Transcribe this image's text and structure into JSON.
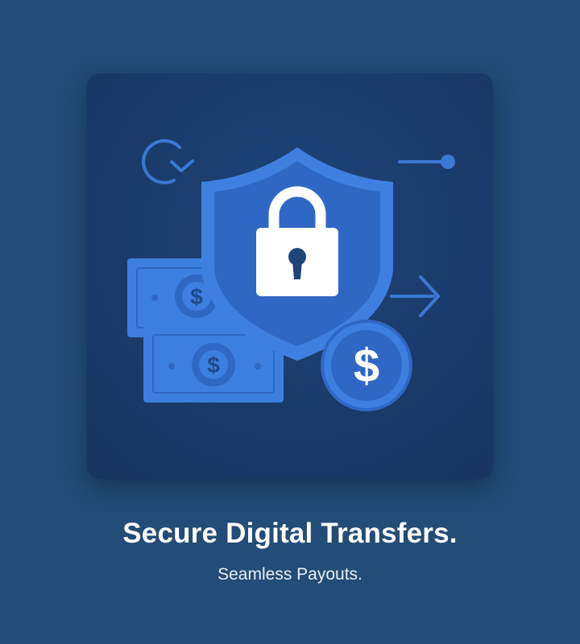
{
  "onboarding": {
    "headline": "Secure Digital Transfers.",
    "subheadline": "Seamless Payouts."
  },
  "illustration": {
    "icons": [
      "refresh-icon",
      "link-icon",
      "shield-lock-icon",
      "banknote-icon",
      "dollar-coin-icon",
      "arrow-right-icon"
    ]
  },
  "colors": {
    "background": "#234c76",
    "card": "#1a3b6a",
    "accent": "#3f7fe0",
    "accent_dark": "#2f67c4",
    "text": "#ffffff"
  }
}
